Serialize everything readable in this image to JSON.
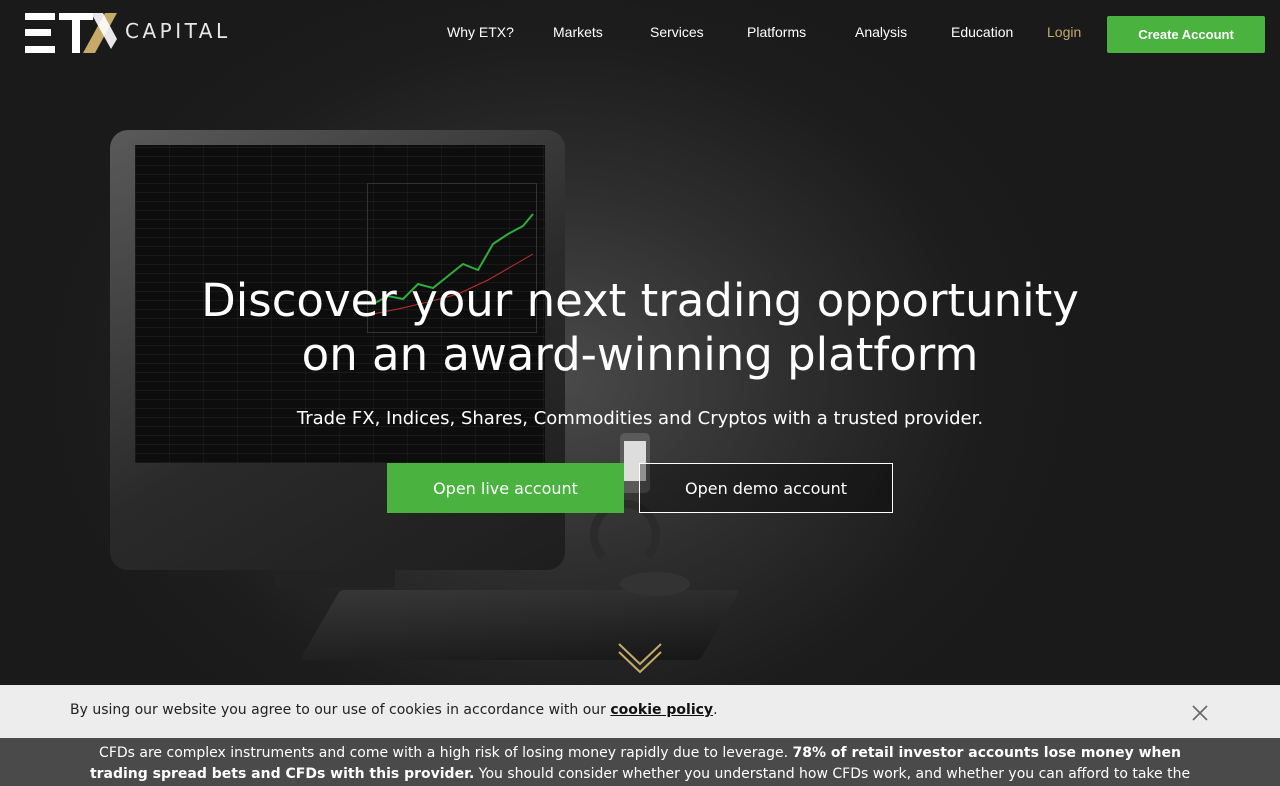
{
  "brand": {
    "logo_text": "CAPITAL",
    "accent_color": "#c7a96a",
    "cta_color": "#4ab23f"
  },
  "nav": {
    "items": [
      "Why ETX?",
      "Markets",
      "Services",
      "Platforms",
      "Analysis",
      "Education"
    ],
    "login": "Login",
    "create_account": "Create Account"
  },
  "hero": {
    "title_line1": "Discover your next trading opportunity",
    "title_line2": "on an award-winning platform",
    "subtitle": "Trade FX, Indices, Shares, Commodities and Cryptos with a trusted provider.",
    "live_button": "Open live account",
    "demo_button": "Open demo account",
    "scroll_icon": "double-chevron-down-icon"
  },
  "cookie": {
    "text_before": "By using our website you agree to our use of cookies in accordance with our ",
    "link": "cookie policy",
    "text_after": ".",
    "close_icon": "close-icon"
  },
  "risk": {
    "text_before": "CFDs are complex instruments and come with a high risk of losing money rapidly due to leverage. ",
    "bold": "78% of retail investor accounts lose money when trading spread bets and CFDs with this provider.",
    "text_after": " You should consider whether you understand how CFDs work, and whether you can afford to take the high risk of losing your money."
  }
}
